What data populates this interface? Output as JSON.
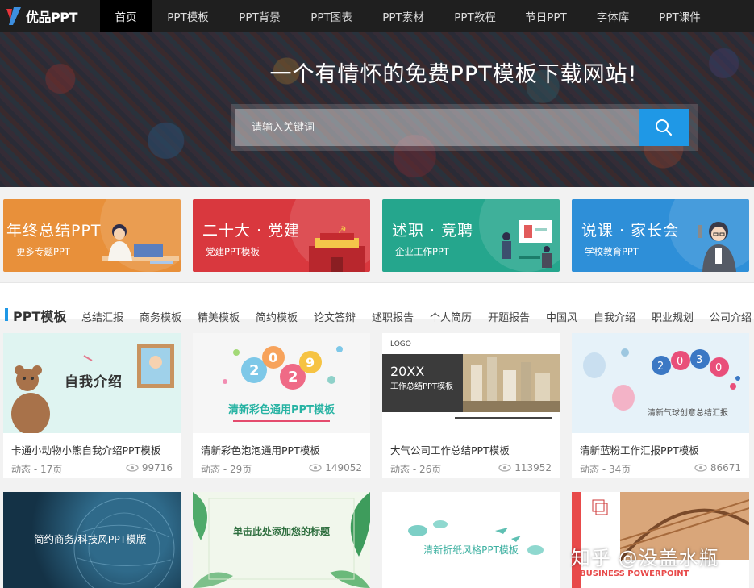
{
  "site": {
    "logo_text": "优品PPT"
  },
  "nav": {
    "items": [
      {
        "label": "首页"
      },
      {
        "label": "PPT模板"
      },
      {
        "label": "PPT背景"
      },
      {
        "label": "PPT图表"
      },
      {
        "label": "PPT素材"
      },
      {
        "label": "PPT教程"
      },
      {
        "label": "节日PPT"
      },
      {
        "label": "字体库"
      },
      {
        "label": "PPT课件"
      }
    ]
  },
  "hero": {
    "title": "一个有情怀的免费PPT模板下载网站!",
    "search_placeholder": "请输入关键词"
  },
  "banners": [
    {
      "title": "年终总结PPT",
      "subtitle": "更多专题PPT",
      "color": "#e8903a"
    },
    {
      "title": "二十大 · 党建",
      "subtitle": "党建PPT模板",
      "color": "#d9383e"
    },
    {
      "title": "述职 · 竞聘",
      "subtitle": "企业工作PPT",
      "color": "#25a68d"
    },
    {
      "title": "说课 · 家长会",
      "subtitle": "学校教育PPT",
      "color": "#2e8fd8"
    }
  ],
  "category": {
    "title": "PPT模板",
    "links": [
      "总结汇报",
      "商务模板",
      "精美模板",
      "简约模板",
      "论文答辩",
      "述职报告",
      "个人简历",
      "开题报告",
      "中国风",
      "自我介绍",
      "职业规划",
      "公司介绍"
    ]
  },
  "cards_row1": [
    {
      "title": "卡通小动物小熊自我介绍PPT模板",
      "meta": "动态 - 17页",
      "views": "99716",
      "thumb_text": "自我介绍"
    },
    {
      "title": "清新彩色泡泡通用PPT模板",
      "meta": "动态 - 29页",
      "views": "149052",
      "thumb_text": "清新彩色通用PPT模板"
    },
    {
      "title": "大气公司工作总结PPT模板",
      "meta": "动态 - 26页",
      "views": "113952",
      "thumb_text": "工作总结PPT模板"
    },
    {
      "title": "清新蓝粉工作汇报PPT模板",
      "meta": "动态 - 34页",
      "views": "86671",
      "thumb_text": "清新气球创意总结汇报"
    }
  ],
  "cards_row2": [
    {
      "thumb_text": "简约商务/科技风PPT模版"
    },
    {
      "thumb_text": "单击此处添加您的标题"
    },
    {
      "thumb_text": "清新折纸风格PPT模板"
    },
    {
      "thumb_text": "BUSINESS POWERPOINT"
    }
  ],
  "watermark": "知乎 @没盖水瓶",
  "colors": {
    "accent": "#1f98e6",
    "nav_bg": "#1f1f1f"
  }
}
